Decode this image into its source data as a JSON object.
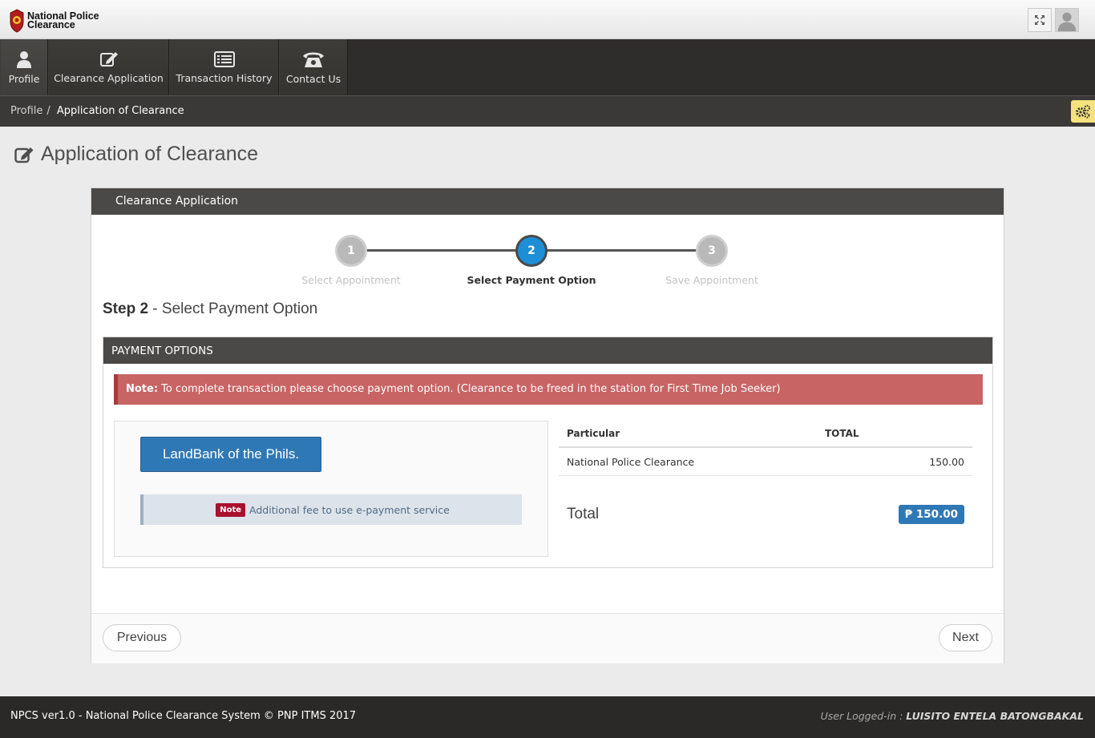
{
  "brand": {
    "line1": "National Police",
    "line2": "Clearance"
  },
  "nav": [
    {
      "label": "Profile",
      "icon": "user-icon"
    },
    {
      "label": "Clearance Application",
      "icon": "edit-icon"
    },
    {
      "label": "Transaction History",
      "icon": "list-icon"
    },
    {
      "label": "Contact Us",
      "icon": "phone-icon"
    }
  ],
  "breadcrumb": {
    "parent": "Profile",
    "separator": "/",
    "current": "Application of Clearance"
  },
  "page": {
    "title": "Application of Clearance"
  },
  "panel": {
    "title": "Clearance Application"
  },
  "steps": [
    {
      "number": "1",
      "label": "Select Appointment",
      "state": "inactive"
    },
    {
      "number": "2",
      "label": "Select Payment Option",
      "state": "active"
    },
    {
      "number": "3",
      "label": "Save Appointment",
      "state": "inactive"
    }
  ],
  "step_heading": {
    "prefix": "Step 2",
    "text": " - Select Payment Option"
  },
  "payment": {
    "header": "PAYMENT OPTIONS",
    "alert_label": "Note:",
    "alert_text": " To complete transaction please choose payment option. (Clearance to be freed in the station for First Time Job Seeker)",
    "bank_button": "LandBank of the Phils.",
    "note_badge": "Note",
    "note_text": "Additional fee to use e-payment service",
    "table": {
      "headers": [
        "Particular",
        "TOTAL"
      ],
      "rows": [
        {
          "particular": "National Police Clearance",
          "total": "150.00"
        }
      ]
    },
    "total_label": "Total",
    "total_value": "₱ 150.00"
  },
  "buttons": {
    "previous": "Previous",
    "next": "Next"
  },
  "footer": {
    "left": "NPCS ver1.0 - National Police Clearance System © PNP ITMS 2017",
    "user_prefix": "User Logged-in : ",
    "user_name": "LUISITO ENTELA BATONGBAKAL"
  },
  "colors": {
    "accent": "#1d8fd6",
    "primary_button": "#2f78b6",
    "alert": "#c86464",
    "header": "#4a4948"
  }
}
